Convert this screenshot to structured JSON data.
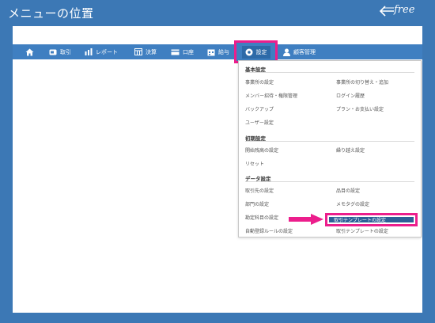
{
  "frame": {
    "title": "メニューの位置",
    "logo_text": "free"
  },
  "colors": {
    "frame_blue": "#3c78b5",
    "nav_blue": "#3f7fc1",
    "accent_pink": "#ec1e8c",
    "selected_item": "#2d5f97"
  },
  "nav": {
    "items": [
      {
        "key": "home",
        "label": "",
        "icon": "home-icon"
      },
      {
        "key": "deals",
        "label": "取引",
        "icon": "wallet-icon"
      },
      {
        "key": "reports",
        "label": "レポート",
        "icon": "chart-icon"
      },
      {
        "key": "closing",
        "label": "決算",
        "icon": "ledger-icon"
      },
      {
        "key": "accounts",
        "label": "口座",
        "icon": "card-icon"
      },
      {
        "key": "payroll",
        "label": "給与",
        "icon": "calendar-icon"
      },
      {
        "key": "settings",
        "label": "設定",
        "icon": "gear-icon"
      },
      {
        "key": "customers",
        "label": "顧客管理",
        "icon": "user-icon"
      }
    ]
  },
  "dropdown": {
    "sections": [
      {
        "heading": "基本設定",
        "items": [
          "事業所の設定",
          "事業所の切り替え・追加",
          "メンバー招待・権限管理",
          "ログイン履歴",
          "バックアップ",
          "プラン・お支払い設定",
          "ユーザー設定"
        ]
      },
      {
        "heading": "初期設定",
        "items": [
          "開始残高の設定",
          "繰り越え設定",
          "リセット"
        ]
      },
      {
        "heading": "データ設定",
        "items": [
          "取引先の設定",
          "品目の設定",
          "部門の設定",
          "メモタグの設定",
          "勘定科目の設定",
          "取引テンプレートの設定",
          "自動登録ルールの設定",
          "取引テンプレートの設定"
        ]
      }
    ]
  }
}
